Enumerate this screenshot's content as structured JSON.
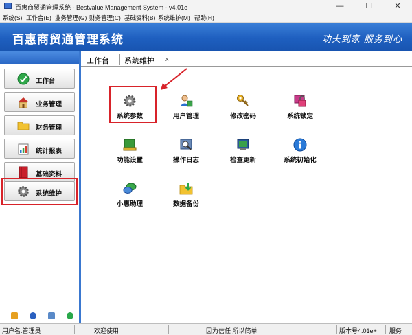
{
  "window": {
    "title": "百惠商贸通管理系统 - Bestvalue Management System - v4.01e",
    "minimize": "—",
    "maximize": "☐",
    "close": "✕"
  },
  "menu": [
    "系统(S)",
    "工作台(E)",
    "业务管理(G)",
    "财务管理(C)",
    "基础资料(B)",
    "系统维护(M)",
    "帮助(H)"
  ],
  "banner": {
    "title": "百惠商贸通管理系统",
    "slogan": "功夫到家 服务到心"
  },
  "sidebar": {
    "items": [
      {
        "label": "工作台",
        "icon": "check-circle-icon"
      },
      {
        "label": "业务管理",
        "icon": "house-icon"
      },
      {
        "label": "财务管理",
        "icon": "folder-icon"
      },
      {
        "label": "统计报表",
        "icon": "report-chart-icon"
      },
      {
        "label": "基础资料",
        "icon": "red-book-icon"
      },
      {
        "label": "系统维护",
        "icon": "gear-icon"
      }
    ],
    "selected": "系统维护"
  },
  "tabs": {
    "workbench": "工作台",
    "active": "系统维护",
    "close": "x"
  },
  "tiles": [
    {
      "label": "系统参数",
      "icon": "gear-icon"
    },
    {
      "label": "用户管理",
      "icon": "user-icon"
    },
    {
      "label": "修改密码",
      "icon": "key-icon"
    },
    {
      "label": "系统锁定",
      "icon": "lock-icon"
    },
    {
      "label": "功能设置",
      "icon": "function-settings-icon"
    },
    {
      "label": "操作日志",
      "icon": "log-icon"
    },
    {
      "label": "检查更新",
      "icon": "update-icon"
    },
    {
      "label": "系统初始化",
      "icon": "info-icon"
    },
    {
      "label": "小惠助理",
      "icon": "chat-bubbles-icon"
    },
    {
      "label": "数据备份",
      "icon": "backup-icon"
    }
  ],
  "statusbar": {
    "user": "用户名:管理员",
    "welcome": "欢迎使用",
    "motto": "因为信任 所以简单",
    "version": "版本号4.01e+",
    "service": "服务"
  },
  "colors": {
    "banner": "#1e5fbf",
    "highlight": "#d8232a",
    "sidebar_border": "#3a78d0"
  }
}
